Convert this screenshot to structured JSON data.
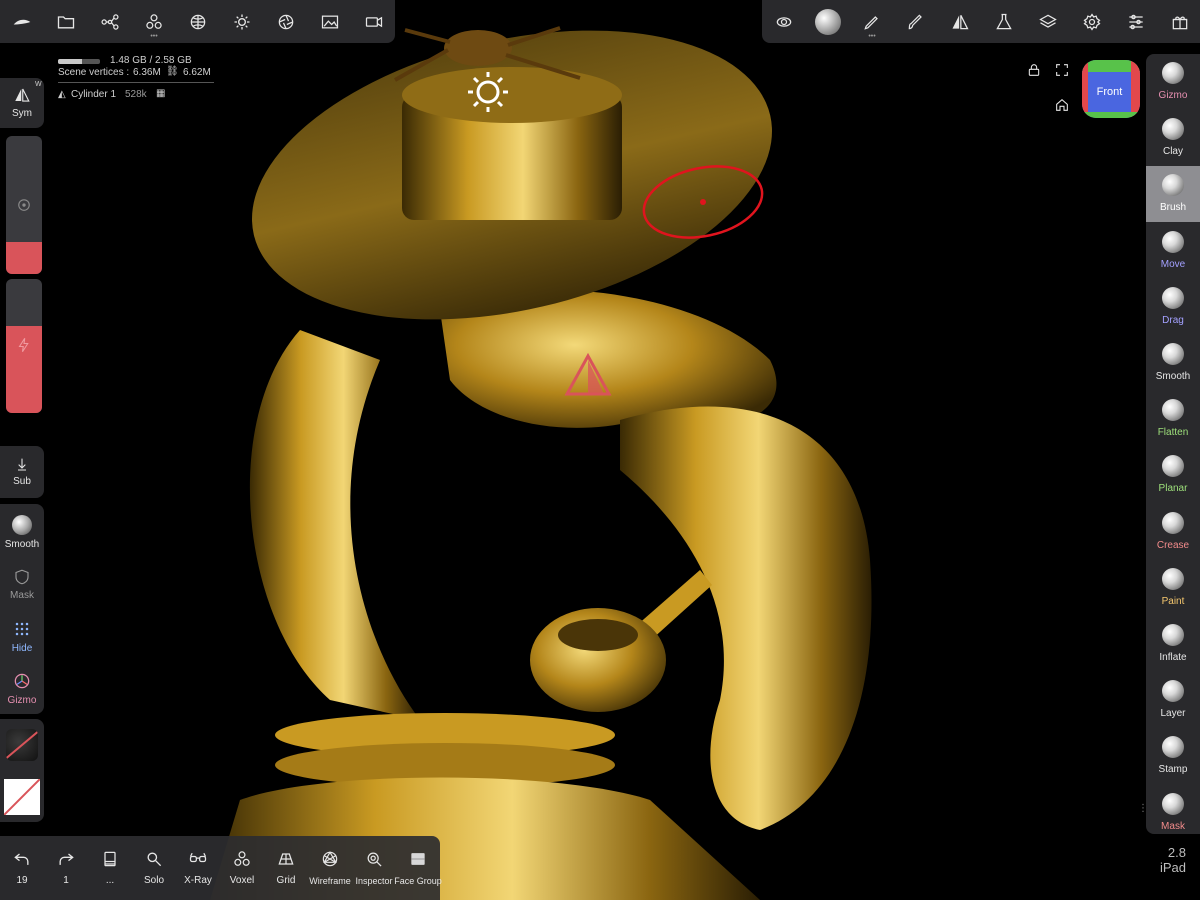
{
  "memory": {
    "text": "1.48 GB / 2.58 GB",
    "fraction": 0.57
  },
  "scene": {
    "vertices_label": "Scene vertices :",
    "vertices_value": "6.36M",
    "faces_value": "6.62M"
  },
  "object": {
    "name": "Cylinder 1",
    "count": "528k"
  },
  "left_panel": {
    "sym_label": "Sym",
    "sym_badge": "W",
    "sub_label": "Sub",
    "smooth_label": "Smooth",
    "mask_label": "Mask",
    "hide_label": "Hide",
    "gizmo_label": "Gizmo"
  },
  "view_cube": {
    "label": "Front"
  },
  "right_tools": [
    {
      "label": "Gizmo",
      "color": "#e58fb0"
    },
    {
      "label": "Clay",
      "color": "#e6e6e6"
    },
    {
      "label": "Brush",
      "color": "#ffffff"
    },
    {
      "label": "Move",
      "color": "#a3a0ff"
    },
    {
      "label": "Drag",
      "color": "#a3a0ff"
    },
    {
      "label": "Smooth",
      "color": "#e6e6e6"
    },
    {
      "label": "Flatten",
      "color": "#9ee07b"
    },
    {
      "label": "Planar",
      "color": "#9ee07b"
    },
    {
      "label": "Crease",
      "color": "#f28b8b"
    },
    {
      "label": "Paint",
      "color": "#f5c76e"
    },
    {
      "label": "Inflate",
      "color": "#e6e6e6"
    },
    {
      "label": "Layer",
      "color": "#e6e6e6"
    },
    {
      "label": "Stamp",
      "color": "#e6e6e6"
    },
    {
      "label": "Mask",
      "color": "#f28b8b"
    }
  ],
  "bottom_toolbar": {
    "undo_count": "19",
    "redo_count": "1",
    "more_label": "...",
    "items": [
      "Solo",
      "X-Ray",
      "Voxel",
      "Grid",
      "Wireframe",
      "Inspector",
      "Face Group"
    ]
  },
  "version": {
    "number": "2.8",
    "device": "iPad"
  },
  "colors": {
    "accent_red": "#d9545a",
    "panel": "#2d2d30",
    "gold": "#b8901f"
  }
}
